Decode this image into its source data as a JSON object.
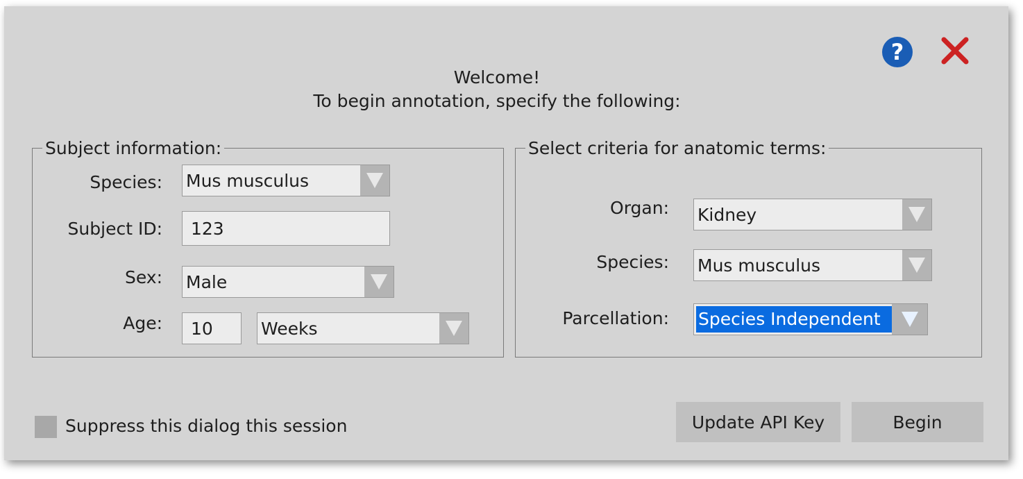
{
  "header": {
    "welcome": "Welcome!",
    "instruction": "To begin annotation, specify the following:"
  },
  "icons": {
    "help": "?",
    "help_color": "#1a5db5",
    "close_color": "#cc2222"
  },
  "subject": {
    "legend": "Subject information:",
    "species_label": "Species:",
    "species_value": "Mus musculus",
    "subject_id_label": "Subject ID:",
    "subject_id_value": "123",
    "sex_label": "Sex:",
    "sex_value": "Male",
    "age_label": "Age:",
    "age_value": "10",
    "age_unit": "Weeks"
  },
  "criteria": {
    "legend": "Select criteria for anatomic terms:",
    "organ_label": "Organ:",
    "organ_value": "Kidney",
    "species_label": "Species:",
    "species_value": "Mus musculus",
    "parcellation_label": "Parcellation:",
    "parcellation_value": "Species Independent"
  },
  "footer": {
    "suppress_label": "Suppress this dialog this session",
    "update_api_key": "Update API Key",
    "begin": "Begin"
  }
}
